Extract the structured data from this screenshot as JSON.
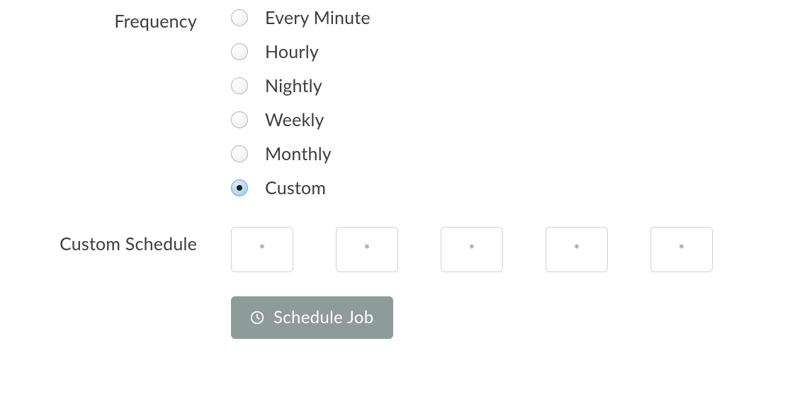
{
  "frequency": {
    "label": "Frequency",
    "options": [
      {
        "label": "Every Minute",
        "selected": false
      },
      {
        "label": "Hourly",
        "selected": false
      },
      {
        "label": "Nightly",
        "selected": false
      },
      {
        "label": "Weekly",
        "selected": false
      },
      {
        "label": "Monthly",
        "selected": false
      },
      {
        "label": "Custom",
        "selected": true
      }
    ]
  },
  "custom_schedule": {
    "label": "Custom Schedule",
    "fields": [
      {
        "placeholder": "*",
        "value": ""
      },
      {
        "placeholder": "*",
        "value": ""
      },
      {
        "placeholder": "*",
        "value": ""
      },
      {
        "placeholder": "*",
        "value": ""
      },
      {
        "placeholder": "*",
        "value": ""
      }
    ]
  },
  "submit": {
    "label": "Schedule Job"
  }
}
